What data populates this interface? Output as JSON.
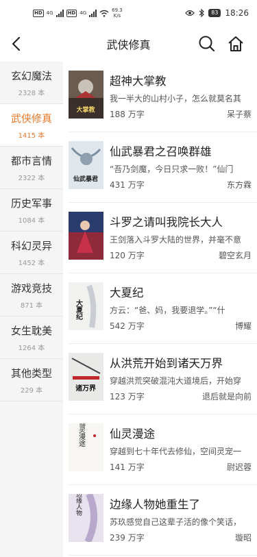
{
  "status_bar": {
    "sim1": "HD",
    "sim2": "HD",
    "net1": "4G",
    "net2": "4G",
    "speed_value": "69.3",
    "speed_unit": "K/s",
    "battery": "83",
    "time": "18:26"
  },
  "header": {
    "title": "武侠修真",
    "icons": [
      "back-arrow-icon",
      "search-icon",
      "home-icon"
    ]
  },
  "sidebar": {
    "active_index": 1,
    "accent_color": "#e8792a",
    "categories": [
      {
        "name": "玄幻魔法",
        "count": "2328 本"
      },
      {
        "name": "武侠修真",
        "count": "1415 本"
      },
      {
        "name": "都市言情",
        "count": "2322 本"
      },
      {
        "name": "历史军事",
        "count": "1084 本"
      },
      {
        "name": "科幻灵异",
        "count": "1452 本"
      },
      {
        "name": "游戏竞技",
        "count": "871 本"
      },
      {
        "name": "女生耽美",
        "count": "1264 本"
      },
      {
        "name": "其他类型",
        "count": "229 本"
      }
    ]
  },
  "books": [
    {
      "title": "超神大掌教",
      "desc": "我一半大的山村小子，怎么就莫名其",
      "words": "188 万字",
      "author": "呆子蔡",
      "cover_text": "大掌教"
    },
    {
      "title": "仙武暴君之召唤群雄",
      "desc": "“吾乃剑魔，今日只求一败！”仙门",
      "words": "431 万字",
      "author": "东方霖",
      "cover_text": "仙武暴君"
    },
    {
      "title": "斗罗之请叫我院长大人",
      "desc": "王剑落入斗罗大陆的世界，并毫不意",
      "words": "120 万字",
      "author": "碧空玄月",
      "cover_text": ""
    },
    {
      "title": "大夏纪",
      "desc": "方云：“爸、妈，我要退学。”“什",
      "words": "542 万字",
      "author": "博耀",
      "cover_text": "大夏纪"
    },
    {
      "title": "从洪荒开始到诸天万界",
      "desc": "穿越洪荒突破混沌大道境后，开始穿",
      "words": "123 万字",
      "author": "退后就是向前",
      "cover_text": "诸万界"
    },
    {
      "title": "仙灵漫途",
      "desc": "穿越到七十年代去修仙，空间灵宠一",
      "words": "141 万字",
      "author": "尉迟蓉",
      "cover_text": "仙灵漫途"
    },
    {
      "title": "边缘人物她重生了",
      "desc": "苏玖感觉自己这辈子活的像个笑话，",
      "words": "239 万字",
      "author": "璇昭",
      "cover_text": "边缘人物"
    }
  ]
}
